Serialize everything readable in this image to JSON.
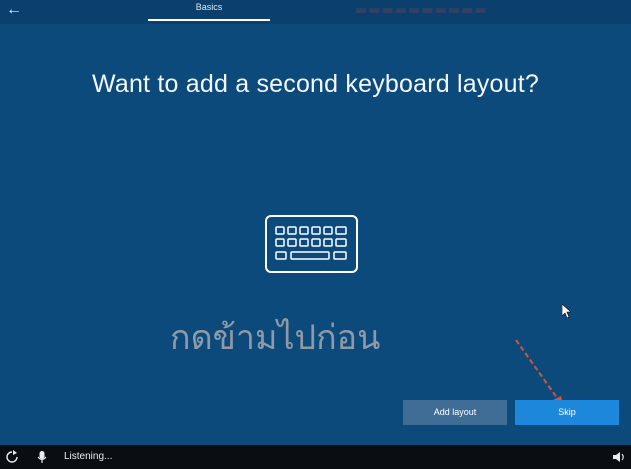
{
  "topbar": {
    "back_icon": "back-arrow-icon",
    "section_label": "Basics"
  },
  "main": {
    "title": "Want to add a second keyboard layout?",
    "illustration_icon": "keyboard-icon",
    "overlay_caption": "กดข้ามไปก่อน"
  },
  "actions": {
    "add_layout_label": "Add layout",
    "skip_label": "Skip"
  },
  "bottombar": {
    "ease_of_access_icon": "ease-of-access-icon",
    "mic_icon": "microphone-icon",
    "status_text": "Listening...",
    "volume_icon": "volume-icon"
  },
  "colors": {
    "background": "#0c4a7c",
    "skip_button": "#1d87dc",
    "add_layout_button": "#3f6d96",
    "annotation_arrow": "#d9542c"
  }
}
